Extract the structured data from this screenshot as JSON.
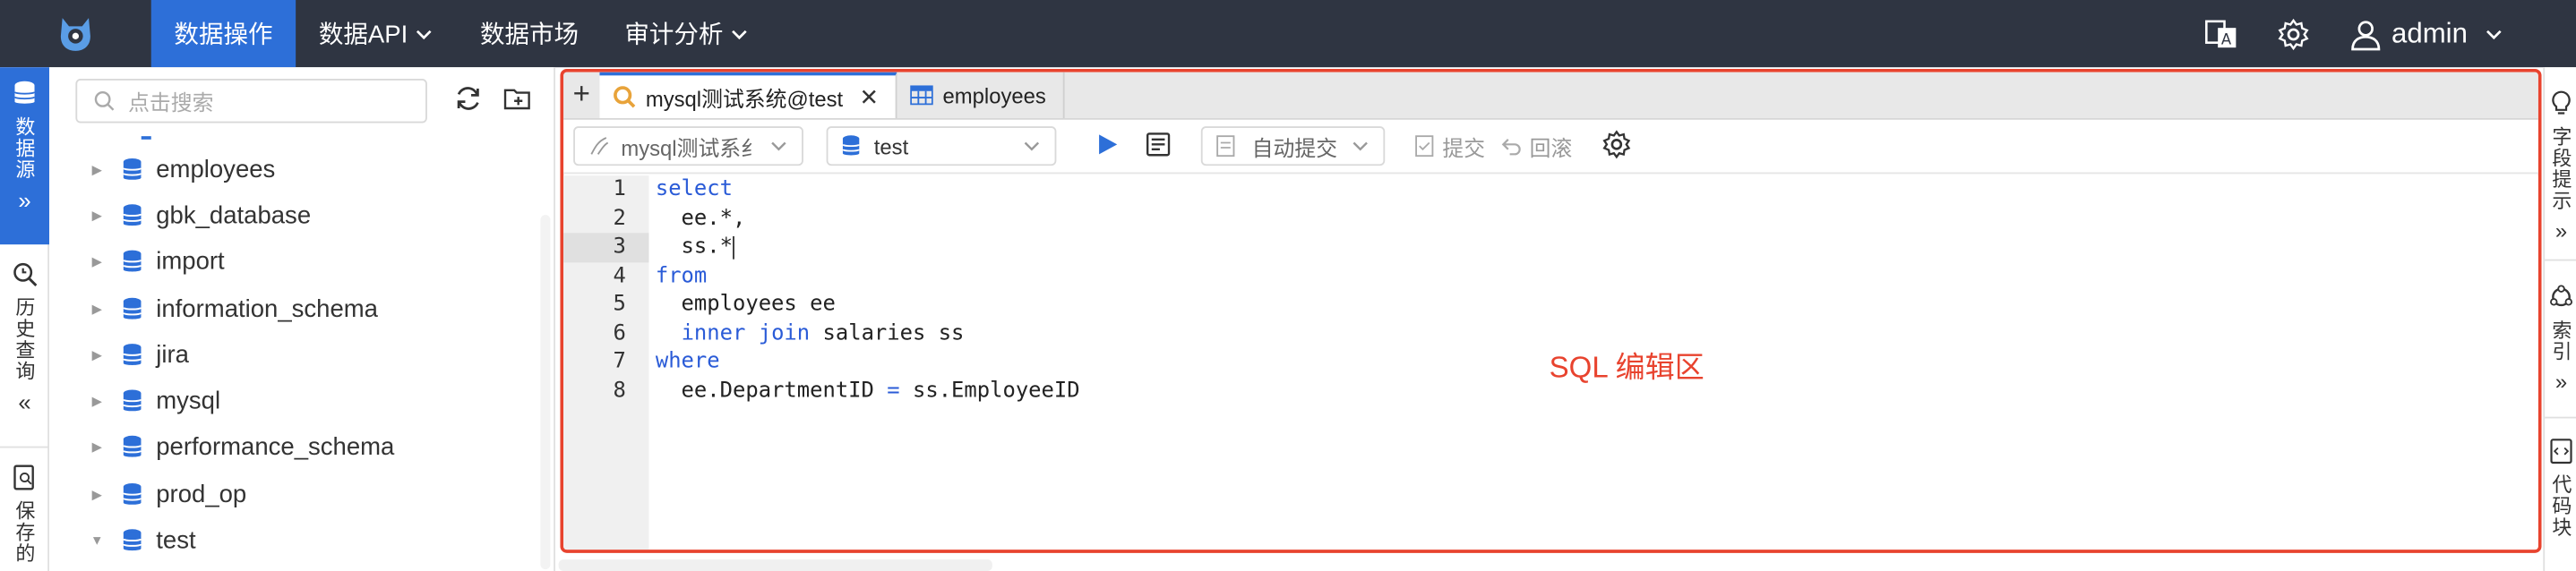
{
  "topnav": {
    "items": [
      {
        "label": "数据操作"
      },
      {
        "label": "数据API"
      },
      {
        "label": "数据市场"
      },
      {
        "label": "审计分析"
      }
    ],
    "user": "admin"
  },
  "left_rail": {
    "sections": [
      {
        "label": "数据源"
      },
      {
        "label": "历史查询"
      },
      {
        "label": "保存的"
      }
    ]
  },
  "sidebar": {
    "search_placeholder": "点击搜索",
    "databases": [
      {
        "name": "employees"
      },
      {
        "name": "gbk_database"
      },
      {
        "name": "import"
      },
      {
        "name": "information_schema"
      },
      {
        "name": "jira"
      },
      {
        "name": "mysql"
      },
      {
        "name": "performance_schema"
      },
      {
        "name": "prod_op"
      },
      {
        "name": "test"
      }
    ]
  },
  "tabs": [
    {
      "label": "mysql测试系统@test",
      "active": true
    },
    {
      "label": "employees",
      "active": false
    }
  ],
  "toolbar": {
    "datasource": "mysql测试系纟",
    "schema": "test",
    "autocommit": "自动提交",
    "commit": "提交",
    "rollback": "回滚"
  },
  "editor": {
    "line_numbers": [
      "1",
      "2",
      "3",
      "4",
      "5",
      "6",
      "7",
      "8"
    ],
    "current_line": 3
  },
  "annotation": "SQL 编辑区",
  "right_rail": {
    "sections": [
      {
        "label": "字段提示"
      },
      {
        "label": "索引"
      },
      {
        "label": "代码块"
      }
    ]
  },
  "colors": {
    "topbar": "#2f3542",
    "accent": "#2d6fd8",
    "highlight": "#e8432e",
    "keyword": "#2a5bd7"
  }
}
